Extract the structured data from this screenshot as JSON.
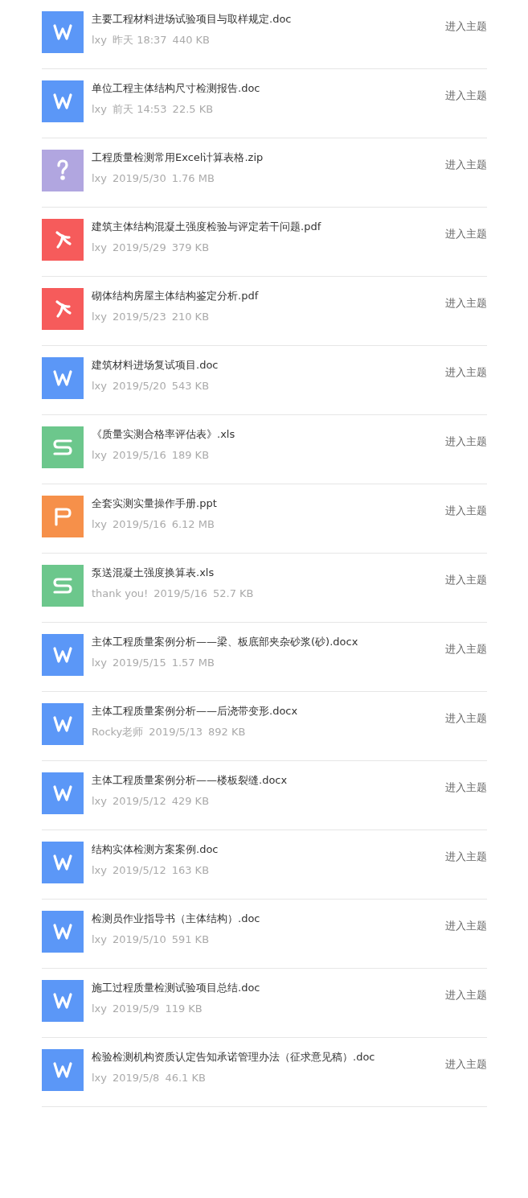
{
  "files": [
    {
      "kind": "doc",
      "name": "主要工程材料进场试验项目与取样规定.doc",
      "author": "lxy",
      "time": "昨天 18:37",
      "size": "440 KB",
      "action": "进入主题"
    },
    {
      "kind": "doc",
      "name": "单位工程主体结构尺寸检测报告.doc",
      "author": "lxy",
      "time": "前天 14:53",
      "size": "22.5 KB",
      "action": "进入主题"
    },
    {
      "kind": "zip",
      "name": "工程质量检测常用Excel计算表格.zip",
      "author": "lxy",
      "time": "2019/5/30",
      "size": "1.76 MB",
      "action": "进入主题"
    },
    {
      "kind": "pdf",
      "name": "建筑主体结构混凝土强度检验与评定若干问题.pdf",
      "author": "lxy",
      "time": "2019/5/29",
      "size": "379 KB",
      "action": "进入主题"
    },
    {
      "kind": "pdf",
      "name": "砌体结构房屋主体结构鉴定分析.pdf",
      "author": "lxy",
      "time": "2019/5/23",
      "size": "210 KB",
      "action": "进入主题"
    },
    {
      "kind": "doc",
      "name": "建筑材料进场复试项目.doc",
      "author": "lxy",
      "time": "2019/5/20",
      "size": "543 KB",
      "action": "进入主题"
    },
    {
      "kind": "xls",
      "name": "《质量实测合格率评估表》.xls",
      "author": "lxy",
      "time": "2019/5/16",
      "size": "189 KB",
      "action": "进入主题"
    },
    {
      "kind": "ppt",
      "name": "全套实测实量操作手册.ppt",
      "author": "lxy",
      "time": "2019/5/16",
      "size": "6.12 MB",
      "action": "进入主题"
    },
    {
      "kind": "xls",
      "name": "泵送混凝土强度换算表.xls",
      "author": "thank you!",
      "time": "2019/5/16",
      "size": "52.7 KB",
      "action": "进入主题"
    },
    {
      "kind": "doc",
      "name": "主体工程质量案例分析——梁、板底部夹杂砂浆(砂).docx",
      "author": "lxy",
      "time": "2019/5/15",
      "size": "1.57 MB",
      "action": "进入主题"
    },
    {
      "kind": "doc",
      "name": "主体工程质量案例分析——后浇带变形.docx",
      "author": "Rocky老师",
      "time": "2019/5/13",
      "size": "892 KB",
      "action": "进入主题"
    },
    {
      "kind": "doc",
      "name": "主体工程质量案例分析——楼板裂缝.docx",
      "author": "lxy",
      "time": "2019/5/12",
      "size": "429 KB",
      "action": "进入主题"
    },
    {
      "kind": "doc",
      "name": "结构实体检测方案案例.doc",
      "author": "lxy",
      "time": "2019/5/12",
      "size": "163 KB",
      "action": "进入主题"
    },
    {
      "kind": "doc",
      "name": "检测员作业指导书（主体结构）.doc",
      "author": "lxy",
      "time": "2019/5/10",
      "size": "591 KB",
      "action": "进入主题"
    },
    {
      "kind": "doc",
      "name": "施工过程质量检测试验项目总结.doc",
      "author": "lxy",
      "time": "2019/5/9",
      "size": "119 KB",
      "action": "进入主题"
    },
    {
      "kind": "doc",
      "name": "检验检测机构资质认定告知承诺管理办法（征求意见稿）.doc",
      "author": "lxy",
      "time": "2019/5/8",
      "size": "46.1 KB",
      "action": "进入主题"
    }
  ]
}
